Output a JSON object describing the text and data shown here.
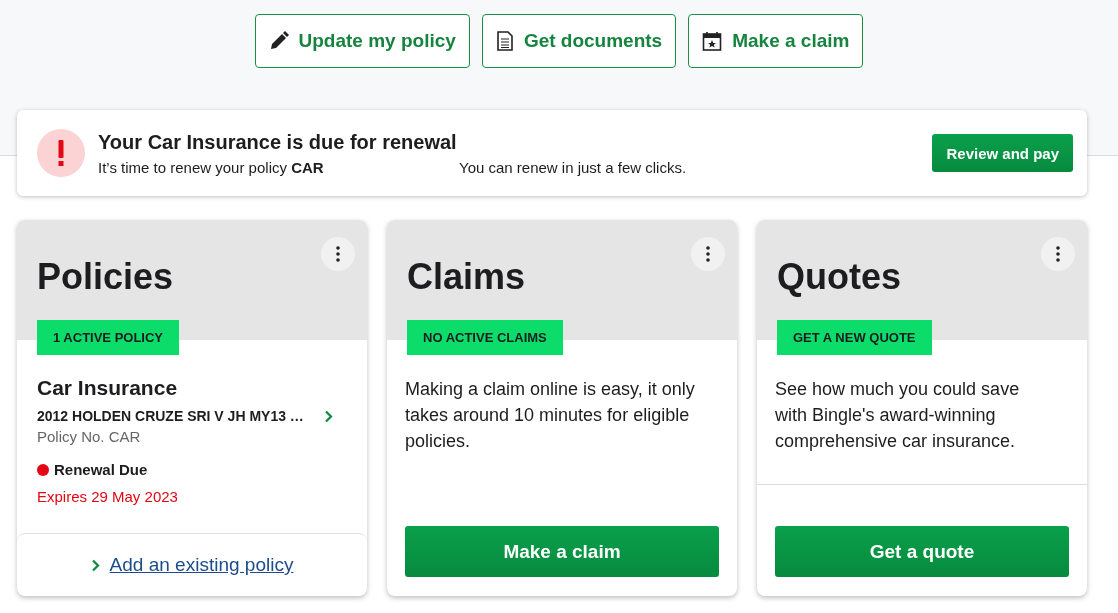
{
  "actions": [
    {
      "kind": "pencil",
      "label": "Update my policy"
    },
    {
      "kind": "document",
      "label": "Get documents"
    },
    {
      "kind": "calendar",
      "label": "Make a claim"
    }
  ],
  "alert": {
    "title": "Your Car Insurance is due for renewal",
    "message": "It’s time to renew your policy **CAR**",
    "note": "You can renew in just a few clicks.",
    "button": "Review and pay"
  },
  "cards": [
    {
      "kind": "policies",
      "title": "Policies",
      "badge": "1 ACTIVE POLICY",
      "policy": {
        "name": "Car Insurance",
        "vehicle": "2012 HOLDEN CRUZE SRI V JH MY13 …",
        "number": "Policy No. CAR",
        "status": "Renewal Due",
        "color": "#e30613",
        "expiry": "Expires 29 May 2023"
      },
      "link": "Add an existing policy"
    },
    {
      "kind": "claims",
      "title": "Claims",
      "badge": "NO ACTIVE CLAIMS",
      "text": "Making a claim online is easy, it only takes around 10 minutes for eligible policies.",
      "button": "Make a claim"
    },
    {
      "kind": "quotes",
      "title": "Quotes",
      "badge": "GET A NEW QUOTE",
      "text": "See how much you could save with Bingle's award-winning comprehensive car insurance.",
      "button": "Get a quote"
    }
  ]
}
